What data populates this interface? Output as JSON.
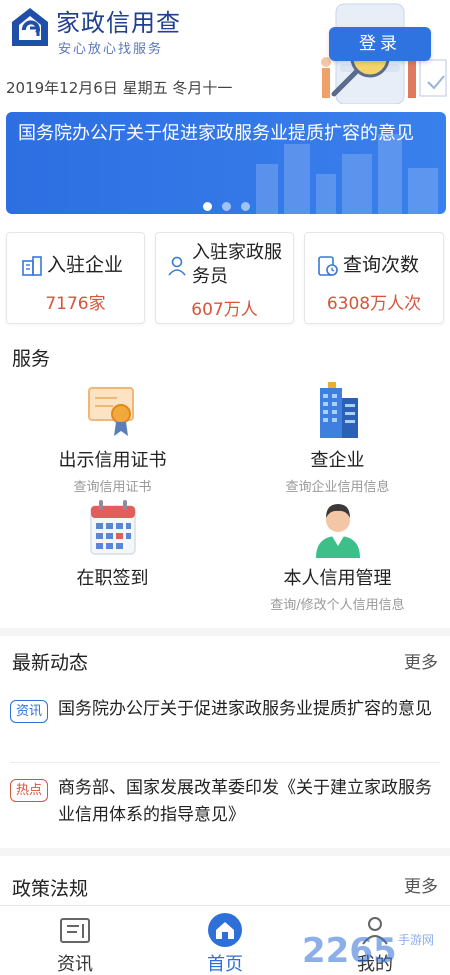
{
  "header": {
    "app_title": "家政信用查",
    "app_subtitle": "安心放心找服务",
    "login_label": "登录",
    "date_line": "2019年12月6日 星期五 冬月十一"
  },
  "banner": {
    "text": "国务院办公厅关于促进家政服务业提质扩容的意见",
    "active_slide": 1,
    "slide_count": 3
  },
  "stats": [
    {
      "label": "入驻企业",
      "value": "7176家",
      "icon": "building-icon"
    },
    {
      "label": "入驻家政服务员",
      "value": "607万人",
      "icon": "person-icon"
    },
    {
      "label": "查询次数",
      "value": "6308万人次",
      "icon": "query-clock-icon"
    }
  ],
  "services": {
    "title": "服务",
    "items": [
      {
        "name": "出示信用证书",
        "desc": "查询信用证书",
        "icon": "certificate-icon"
      },
      {
        "name": "查企业",
        "desc": "查询企业信用信息",
        "icon": "office-building-icon"
      },
      {
        "name": "在职签到",
        "desc": "",
        "icon": "calendar-icon"
      },
      {
        "name": "本人信用管理",
        "desc": "查询/修改个人信用信息",
        "icon": "user-avatar-icon"
      }
    ]
  },
  "news": {
    "title": "最新动态",
    "more_label": "更多",
    "items": [
      {
        "tag": "资讯",
        "tag_color": "#2f6fd8",
        "text": "国务院办公厅关于促进家政服务业提质扩容的意见"
      },
      {
        "tag": "热点",
        "tag_color": "#d5553d",
        "text": "商务部、国家发展改革委印发《关于建立家政服务业信用体系的指导意见》"
      }
    ]
  },
  "policy": {
    "title": "政策法规",
    "more_label": "更多"
  },
  "tabbar": {
    "items": [
      {
        "label": "资讯",
        "icon": "news-icon",
        "active": false
      },
      {
        "label": "首页",
        "icon": "home-icon",
        "active": true
      },
      {
        "label": "我的",
        "icon": "profile-icon",
        "active": false
      }
    ]
  },
  "watermark": {
    "brand_number": "2265",
    "brand_text": "手游网"
  },
  "colors": {
    "primary": "#2f73e0",
    "title_blue": "#1f3f8f",
    "stat_value": "#d5553d",
    "tag_blue": "#2f6fd8",
    "tag_red": "#d5553d"
  }
}
